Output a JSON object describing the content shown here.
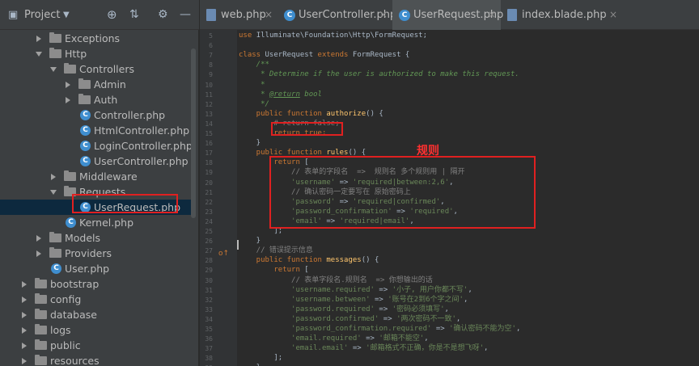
{
  "project": {
    "title": "Project"
  },
  "tree": [
    {
      "label": "Exceptions",
      "kind": "folder",
      "indent": 1,
      "arrow": "right"
    },
    {
      "label": "Http",
      "kind": "folder",
      "indent": 1,
      "arrow": "down"
    },
    {
      "label": "Controllers",
      "kind": "folder",
      "indent": 2,
      "arrow": "down"
    },
    {
      "label": "Admin",
      "kind": "folder",
      "indent": 3,
      "arrow": "right"
    },
    {
      "label": "Auth",
      "kind": "folder",
      "indent": 3,
      "arrow": "right"
    },
    {
      "label": "Controller.php",
      "kind": "class",
      "indent": 3,
      "arrow": ""
    },
    {
      "label": "HtmlController.php",
      "kind": "class",
      "indent": 3,
      "arrow": ""
    },
    {
      "label": "LoginController.php",
      "kind": "class",
      "indent": 3,
      "arrow": ""
    },
    {
      "label": "UserController.php",
      "kind": "class",
      "indent": 3,
      "arrow": ""
    },
    {
      "label": "Middleware",
      "kind": "folder",
      "indent": 2,
      "arrow": "right"
    },
    {
      "label": "Requests",
      "kind": "folder",
      "indent": 2,
      "arrow": "down"
    },
    {
      "label": "UserRequest.php",
      "kind": "class",
      "indent": 3,
      "arrow": "",
      "selected": true
    },
    {
      "label": "Kernel.php",
      "kind": "class",
      "indent": 2,
      "arrow": ""
    },
    {
      "label": "Models",
      "kind": "folder",
      "indent": 1,
      "arrow": "right"
    },
    {
      "label": "Providers",
      "kind": "folder",
      "indent": 1,
      "arrow": "right"
    },
    {
      "label": "User.php",
      "kind": "class",
      "indent": 1,
      "arrow": ""
    },
    {
      "label": "bootstrap",
      "kind": "folder",
      "indent": 0,
      "arrow": "right"
    },
    {
      "label": "config",
      "kind": "folder",
      "indent": 0,
      "arrow": "right"
    },
    {
      "label": "database",
      "kind": "folder",
      "indent": 0,
      "arrow": "right"
    },
    {
      "label": "logs",
      "kind": "folder",
      "indent": 0,
      "arrow": "right"
    },
    {
      "label": "public",
      "kind": "folder",
      "indent": 0,
      "arrow": "right"
    },
    {
      "label": "resources",
      "kind": "folder",
      "indent": 0,
      "arrow": "right"
    }
  ],
  "tabs": [
    {
      "label": "web.php",
      "kind": "file",
      "active": false
    },
    {
      "label": "UserController.php",
      "kind": "class",
      "active": false
    },
    {
      "label": "UserRequest.php",
      "kind": "class",
      "active": true
    },
    {
      "label": "index.blade.php",
      "kind": "file",
      "active": false
    }
  ],
  "annotation": "规则",
  "code": [
    {
      "n": "5",
      "segs": [
        [
          "kw",
          "use "
        ],
        [
          "",
          "Illuminate\\Foundation\\Http\\FormRequest;"
        ]
      ]
    },
    {
      "n": "6",
      "segs": []
    },
    {
      "n": "7",
      "segs": [
        [
          "kw",
          "class "
        ],
        [
          "",
          "UserRequest "
        ],
        [
          "kw",
          "extends "
        ],
        [
          "",
          "FormRequest {"
        ]
      ]
    },
    {
      "n": "8",
      "segs": [
        [
          "doc",
          "    /**"
        ]
      ]
    },
    {
      "n": "9",
      "segs": [
        [
          "doc",
          "     * Determine if the user is authorized to make this request."
        ]
      ]
    },
    {
      "n": "10",
      "segs": [
        [
          "doc",
          "     *"
        ]
      ]
    },
    {
      "n": "11",
      "segs": [
        [
          "doc",
          "     * "
        ],
        [
          "tag",
          "@return"
        ],
        [
          "doc",
          " bool"
        ]
      ]
    },
    {
      "n": "12",
      "segs": [
        [
          "doc",
          "     */"
        ]
      ]
    },
    {
      "n": "13",
      "segs": [
        [
          "kw",
          "    public function "
        ],
        [
          "fn",
          "authorize"
        ],
        [
          "",
          "() {"
        ]
      ]
    },
    {
      "n": "14",
      "segs": [
        [
          "com",
          "        # return false;"
        ]
      ]
    },
    {
      "n": "15",
      "segs": [
        [
          "kw",
          "        return true;"
        ]
      ]
    },
    {
      "n": "16",
      "segs": [
        [
          "",
          "    }"
        ]
      ]
    },
    {
      "n": "17",
      "segs": [
        [
          "kw",
          "    public function "
        ],
        [
          "fn",
          "rules"
        ],
        [
          "",
          "() {"
        ]
      ]
    },
    {
      "n": "18",
      "segs": [
        [
          "kw",
          "        return "
        ],
        [
          "",
          "["
        ]
      ]
    },
    {
      "n": "19",
      "segs": [
        [
          "com",
          "            // 表单的字段名  =>  规则名 多个规则用 | 隔开"
        ]
      ]
    },
    {
      "n": "20",
      "segs": [
        [
          "str",
          "            'username'"
        ],
        [
          "",
          " => "
        ],
        [
          "str",
          "'required|between:2,6'"
        ],
        [
          "",
          ","
        ]
      ]
    },
    {
      "n": "21",
      "segs": [
        [
          "com",
          "            // 确认密码一定要写在 原始密码上"
        ]
      ]
    },
    {
      "n": "22",
      "segs": [
        [
          "str",
          "            'password'"
        ],
        [
          "",
          " => "
        ],
        [
          "str",
          "'required|confirmed'"
        ],
        [
          "",
          ","
        ]
      ]
    },
    {
      "n": "23",
      "segs": [
        [
          "str",
          "            'password_confirmation'"
        ],
        [
          "",
          " => "
        ],
        [
          "str",
          "'required'"
        ],
        [
          "",
          ","
        ]
      ]
    },
    {
      "n": "24",
      "segs": [
        [
          "str",
          "            'email'"
        ],
        [
          "",
          " => "
        ],
        [
          "str",
          "'required|email'"
        ],
        [
          "",
          ","
        ]
      ]
    },
    {
      "n": "25",
      "segs": [
        [
          "",
          "        ];"
        ]
      ]
    },
    {
      "n": "26",
      "segs": [
        [
          "",
          "    }"
        ]
      ]
    },
    {
      "n": "27",
      "segs": [
        [
          "com",
          "    // 错误提示信息"
        ]
      ]
    },
    {
      "n": "28",
      "segs": [
        [
          "kw",
          "    public function "
        ],
        [
          "fn",
          "messages"
        ],
        [
          "",
          "() {"
        ]
      ]
    },
    {
      "n": "29",
      "segs": [
        [
          "kw",
          "        return "
        ],
        [
          "",
          "["
        ]
      ]
    },
    {
      "n": "30",
      "segs": [
        [
          "com",
          "            // 表单字段名.规则名  => 你想输出的话"
        ]
      ]
    },
    {
      "n": "31",
      "segs": [
        [
          "str",
          "            'username.required'"
        ],
        [
          "",
          " => "
        ],
        [
          "str",
          "'小子, 用户你都不写'"
        ],
        [
          "",
          ","
        ]
      ]
    },
    {
      "n": "32",
      "segs": [
        [
          "str",
          "            'username.between'"
        ],
        [
          "",
          " => "
        ],
        [
          "str",
          "'账号在2到6个字之间'"
        ],
        [
          "",
          ","
        ]
      ]
    },
    {
      "n": "33",
      "segs": [
        [
          "str",
          "            'password.required'"
        ],
        [
          "",
          " => "
        ],
        [
          "str",
          "'密码必须填写'"
        ],
        [
          "",
          ","
        ]
      ]
    },
    {
      "n": "34",
      "segs": [
        [
          "str",
          "            'password.confirmed'"
        ],
        [
          "",
          " => "
        ],
        [
          "str",
          "'两次密码不一致'"
        ],
        [
          "",
          ","
        ]
      ]
    },
    {
      "n": "35",
      "segs": [
        [
          "str",
          "            'password_confirmation.required'"
        ],
        [
          "",
          " => "
        ],
        [
          "str",
          "'确认密码不能为空'"
        ],
        [
          "",
          ","
        ]
      ]
    },
    {
      "n": "36",
      "segs": [
        [
          "str",
          "            'email.required'"
        ],
        [
          "",
          " => "
        ],
        [
          "str",
          "'邮箱不能空'"
        ],
        [
          "",
          ","
        ]
      ]
    },
    {
      "n": "37",
      "segs": [
        [
          "str",
          "            'email.email'"
        ],
        [
          "",
          " => "
        ],
        [
          "str",
          "'邮箱格式不正确，你是不是想飞呀'"
        ],
        [
          "",
          ","
        ]
      ]
    },
    {
      "n": "38",
      "segs": [
        [
          "",
          "        ];"
        ]
      ]
    },
    {
      "n": "39",
      "segs": [
        [
          "",
          "    }"
        ]
      ]
    }
  ]
}
